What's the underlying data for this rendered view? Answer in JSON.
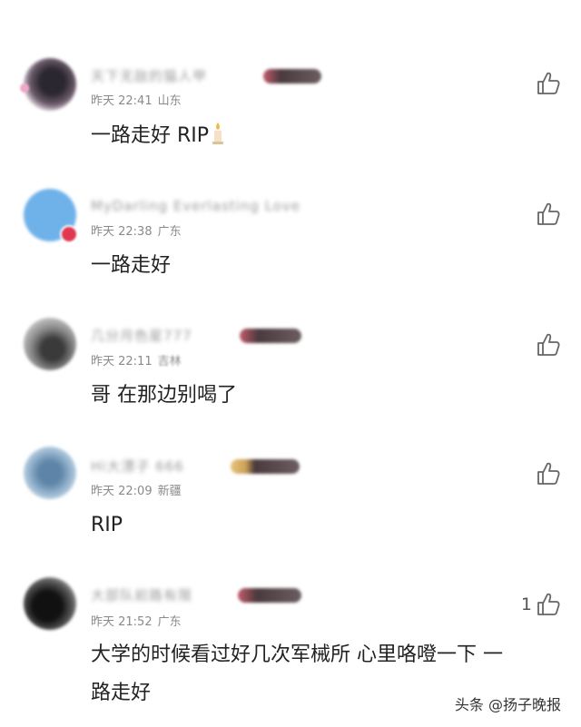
{
  "comments": [
    {
      "name": "天下无敌的猫人甲",
      "time": "昨天 22:41",
      "location": "山东",
      "text": "一路走好 RIP",
      "icon": "candle-icon",
      "likes": ""
    },
    {
      "name": "MyDarling Everlasting Love",
      "time": "昨天 22:38",
      "location": "广东",
      "text": "一路走好",
      "likes": ""
    },
    {
      "name": "几分月色星777",
      "time": "昨天 22:11",
      "location": "吉林",
      "text": "哥 在那边别喝了",
      "likes": ""
    },
    {
      "name": "Hi大漂子 666",
      "time": "昨天 22:09",
      "location": "新疆",
      "text": "RIP",
      "likes": ""
    },
    {
      "name": "大部队前路有限",
      "time": "昨天 21:52",
      "location": "广东",
      "text_line1": "大学的时候看过好几次军械所 心里咯噔一下 一",
      "text_line2": "路走好",
      "likes": "1"
    }
  ],
  "watermark": "头条 @扬子晚报",
  "colors": {
    "accent_red": "#e0384f",
    "meta_gray": "#8a8a8a"
  }
}
